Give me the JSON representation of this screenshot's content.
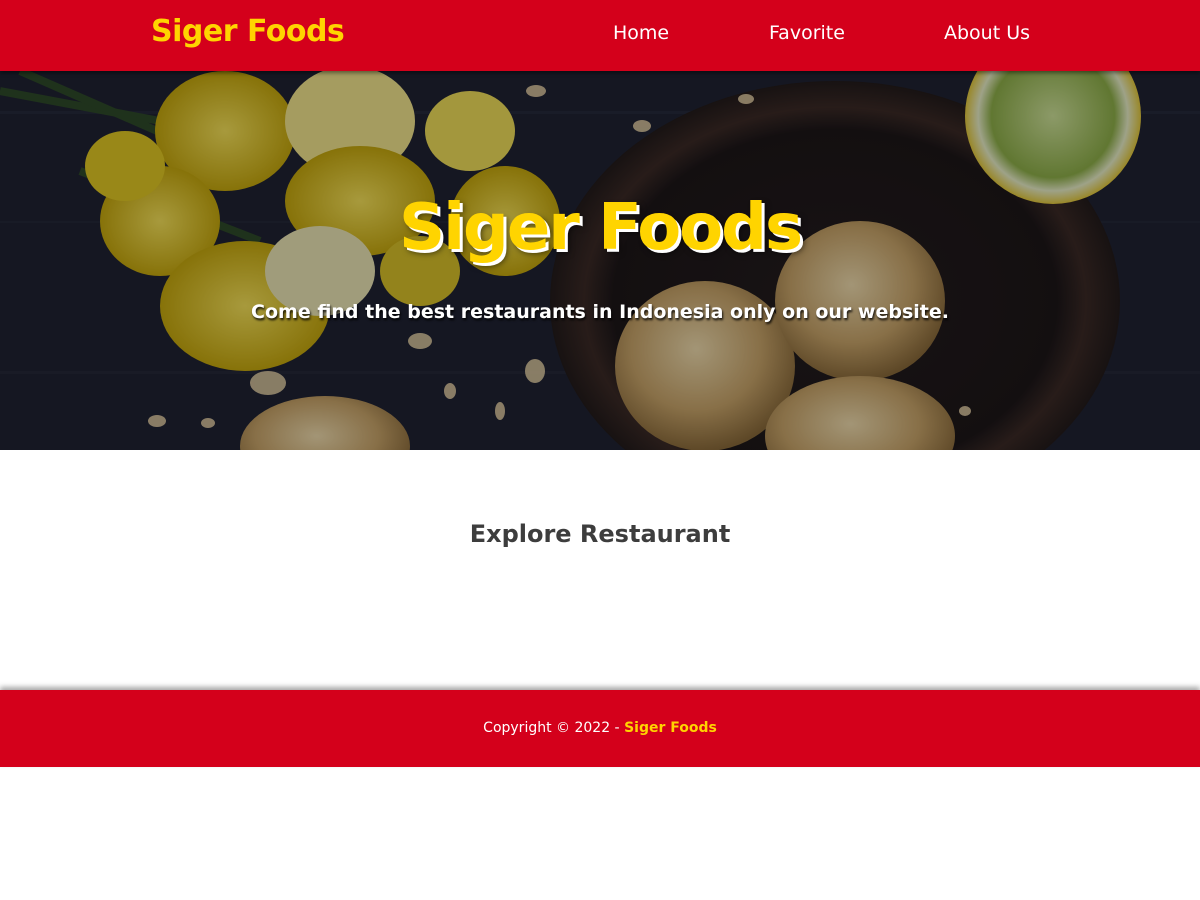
{
  "header": {
    "brand": "Siger Foods",
    "nav": [
      {
        "label": "Home"
      },
      {
        "label": "Favorite"
      },
      {
        "label": "About Us"
      }
    ]
  },
  "hero": {
    "title": "Siger Foods",
    "subtitle": "Come find the best restaurants in Indonesia only on our website."
  },
  "main": {
    "heading": "Explore Restaurant"
  },
  "footer": {
    "copyright_prefix": "Copyright © 2022 - ",
    "brand": "Siger Foods"
  },
  "colors": {
    "primary_red": "#d4001b",
    "accent_yellow": "#ffd400",
    "heading_gray": "#3d3d3d"
  }
}
